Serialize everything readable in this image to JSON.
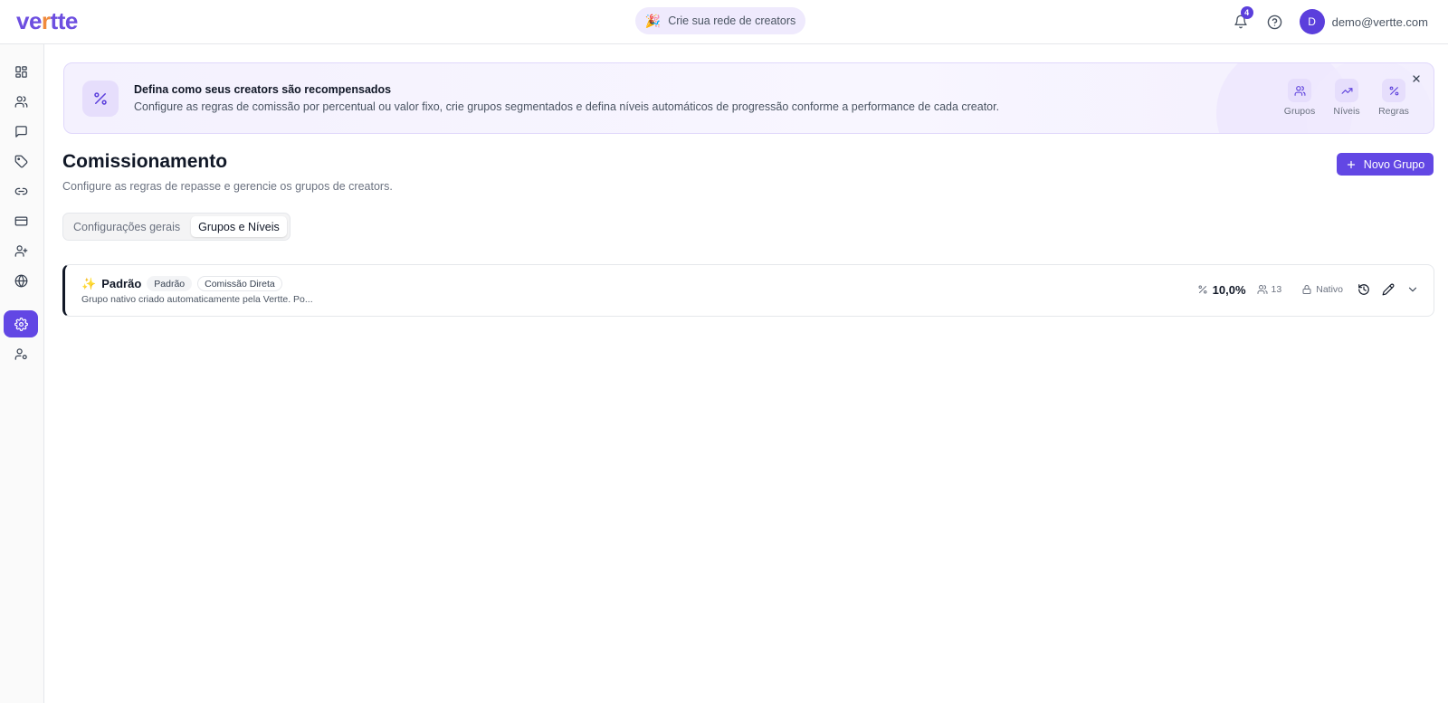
{
  "app": {
    "logo_text": "vertte",
    "promo_emoji": "🎉",
    "promo_label": "Crie sua rede de creators",
    "notifications_count": "4",
    "user_initial": "D",
    "user_email": "demo@vertte.com"
  },
  "sidebar": {
    "items": [
      {
        "icon": "dashboard-icon",
        "active": false
      },
      {
        "icon": "users-icon",
        "active": false
      },
      {
        "icon": "message-icon",
        "active": false
      },
      {
        "icon": "tag-icon",
        "active": false
      },
      {
        "icon": "link-icon",
        "active": false
      },
      {
        "icon": "credit-card-icon",
        "active": false
      },
      {
        "icon": "user-plus-icon",
        "active": false
      },
      {
        "icon": "globe-icon",
        "active": false
      },
      {
        "icon": "settings-icon",
        "active": true
      },
      {
        "icon": "user-settings-icon",
        "active": false
      }
    ]
  },
  "banner": {
    "title": "Defina como seus creators são recompensados",
    "description": "Configure as regras de comissão por percentual ou valor fixo, crie grupos segmentados e defina níveis automáticos de progressão conforme a performance de cada creator.",
    "actions": [
      {
        "label": "Grupos",
        "icon": "users-icon"
      },
      {
        "label": "Níveis",
        "icon": "trending-up-icon"
      },
      {
        "label": "Regras",
        "icon": "percent-icon"
      }
    ]
  },
  "page": {
    "title": "Comissionamento",
    "subtitle": "Configure as regras de repasse e gerencie os grupos de creators.",
    "new_group_label": "Novo Grupo"
  },
  "tabs": [
    {
      "label": "Configurações gerais",
      "active": false
    },
    {
      "label": "Grupos e Níveis",
      "active": true
    }
  ],
  "groups": [
    {
      "emoji": "✨",
      "name": "Padrão",
      "tags": [
        "Padrão",
        "Comissão Direta"
      ],
      "description": "Grupo nativo criado automaticamente pela Vertte. Po...",
      "rate": "10,0%",
      "members": "13",
      "native_label": "Nativo"
    }
  ],
  "colors": {
    "accent": "#6247e4",
    "accent_soft": "#efeafd",
    "border": "#e5e7eb"
  }
}
